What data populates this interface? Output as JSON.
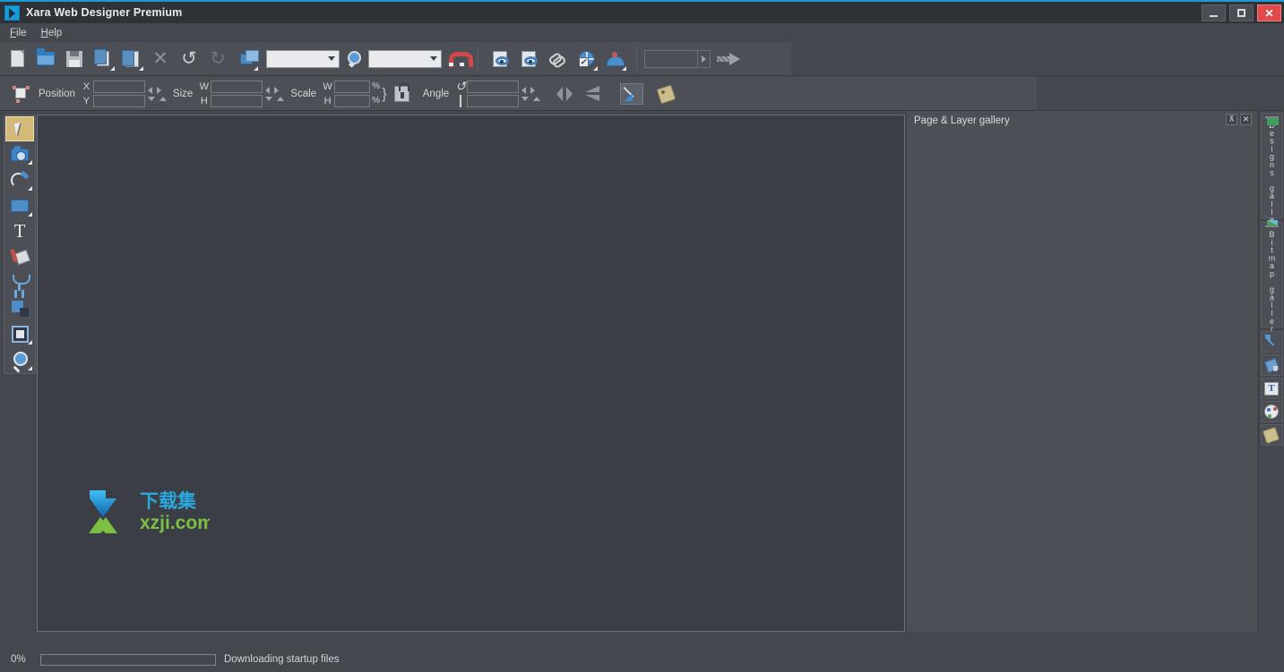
{
  "window": {
    "title": "Xara Web Designer Premium",
    "app_icon": "xara-logo-icon",
    "accent_color": "#1a9ad6",
    "controls": {
      "minimize": "minimize-icon",
      "maximize": "maximize-icon",
      "close": "close-icon"
    }
  },
  "menubar": {
    "items": [
      {
        "label": "File",
        "accesskey": "F"
      },
      {
        "label": "Help",
        "accesskey": "H"
      }
    ]
  },
  "toolbar": {
    "groups": [
      {
        "buttons": [
          {
            "name": "new-document-button",
            "icon": "new-page-icon",
            "label": "New"
          },
          {
            "name": "open-document-button",
            "icon": "open-folder-icon",
            "label": "Open"
          },
          {
            "name": "save-document-button",
            "icon": "save-disk-icon",
            "label": "Save"
          },
          {
            "name": "copy-button",
            "icon": "copy-icon",
            "label": "Copy"
          },
          {
            "name": "paste-button",
            "icon": "paste-icon",
            "label": "Paste"
          },
          {
            "name": "delete-button",
            "icon": "delete-x-icon",
            "label": "Delete"
          },
          {
            "name": "undo-button",
            "icon": "undo-arrow-icon",
            "label": "Undo"
          },
          {
            "name": "redo-button",
            "icon": "redo-arrow-icon",
            "label": "Redo"
          },
          {
            "name": "arrange-button",
            "icon": "arrange-objects-icon",
            "label": "Arrange"
          }
        ]
      }
    ],
    "quality_combo": {
      "value": "",
      "placeholder": ""
    },
    "zoom_tool_icon": "zoom-tool-icon",
    "zoom_combo": {
      "value": "",
      "placeholder": ""
    },
    "snap_button": {
      "icon": "magnet-snap-icon",
      "label": "Snap to objects"
    },
    "web_buttons": [
      {
        "name": "preview-page-button",
        "icon": "preview-page-eye-icon",
        "label": "Preview page"
      },
      {
        "name": "preview-website-button",
        "icon": "preview-website-eye-icon",
        "label": "Preview website"
      },
      {
        "name": "web-link-button",
        "icon": "link-chain-icon",
        "label": "Link"
      },
      {
        "name": "web-properties-button",
        "icon": "globe-check-icon",
        "label": "Web properties"
      },
      {
        "name": "publish-website-button",
        "icon": "publish-globe-icon",
        "label": "Publish website"
      }
    ],
    "address_field": {
      "value": "",
      "placeholder": ""
    },
    "address_dropdown_icon": "chevron-right-icon",
    "go_button": {
      "icon": "go-arrow-icon",
      "label": "Go"
    }
  },
  "infobar": {
    "selection_icon": "selection-handles-icon",
    "position": {
      "label": "Position",
      "x": {
        "label": "X",
        "value": ""
      },
      "y": {
        "label": "Y",
        "value": ""
      }
    },
    "size": {
      "label": "Size",
      "w": {
        "label": "W",
        "value": ""
      },
      "h": {
        "label": "H",
        "value": ""
      }
    },
    "scale": {
      "label": "Scale",
      "w": {
        "label": "W",
        "value": "",
        "unit": "%"
      },
      "h": {
        "label": "H",
        "value": "",
        "unit": "%"
      },
      "lock_icon": "lock-aspect-ratio-icon"
    },
    "angle": {
      "label": "Angle",
      "rotate": {
        "icon": "rotate-icon",
        "value": ""
      },
      "skew": {
        "icon": "skew-icon",
        "value": ""
      }
    },
    "flip_horizontal": {
      "name": "flip-horizontal-button",
      "icon": "flip-horizontal-icon"
    },
    "flip_vertical": {
      "name": "flip-vertical-button",
      "icon": "flip-vertical-icon"
    },
    "line_arrow": {
      "name": "line-arrow-button",
      "icon": "line-arrow-icon",
      "selected": true
    },
    "object_name": {
      "name": "object-name-button",
      "icon": "name-tag-icon"
    }
  },
  "toolbox": {
    "tools": [
      {
        "name": "selector-tool",
        "icon": "selector-arrow-icon",
        "label": "Selector Tool",
        "selected": true,
        "flyout": false
      },
      {
        "name": "photo-tool",
        "icon": "camera-photo-icon",
        "label": "Photo Tool",
        "selected": false,
        "flyout": true
      },
      {
        "name": "freehand-tool",
        "icon": "pen-freehand-icon",
        "label": "Freehand & Brush Tool",
        "selected": false,
        "flyout": true
      },
      {
        "name": "rectangle-tool",
        "icon": "rectangle-icon",
        "label": "Rectangle Tool",
        "selected": false,
        "flyout": true
      },
      {
        "name": "text-tool",
        "icon": "text-t-icon",
        "label": "Text Tool",
        "selected": false,
        "flyout": false
      },
      {
        "name": "fill-tool",
        "icon": "fill-bucket-icon",
        "label": "Fill Tool",
        "selected": false,
        "flyout": false
      },
      {
        "name": "transparency-tool",
        "icon": "transparency-glass-icon",
        "label": "Transparency Tool",
        "selected": false,
        "flyout": false
      },
      {
        "name": "shadow-tool",
        "icon": "shadow-tool-icon",
        "label": "Shadow Tool",
        "selected": false,
        "flyout": false
      },
      {
        "name": "live-effects-tool",
        "icon": "live-effects-icon",
        "label": "Live Effects Tool",
        "selected": false,
        "flyout": true
      },
      {
        "name": "zoom-tool",
        "icon": "magnifier-icon",
        "label": "Zoom Tool",
        "selected": false,
        "flyout": true
      }
    ]
  },
  "canvas": {
    "background_color": "#3b3f45",
    "watermark": {
      "cn_text": "下载集",
      "domain": "xzji.com",
      "logo_colors": [
        "#29a9e0",
        "#1b77c9",
        "#7bc043"
      ]
    }
  },
  "gallery_panel": {
    "title": "Page & Layer gallery",
    "pin_button": {
      "name": "pin-panel-button",
      "icon": "pin-icon",
      "glyph": "⊼"
    },
    "close_button": {
      "name": "close-panel-button",
      "icon": "close-icon",
      "glyph": "✕"
    }
  },
  "right_rail": {
    "tabs": [
      {
        "name": "designs-gallery-tab",
        "label": "Designs gallery",
        "icon": "designs-gallery-icon"
      },
      {
        "name": "bitmap-gallery-tab",
        "label": "Bitmap gallery",
        "icon": "bitmap-gallery-icon"
      }
    ],
    "buttons": [
      {
        "name": "scale-gallery-button",
        "icon": "resize-arrow-icon"
      },
      {
        "name": "fill-gallery-button",
        "icon": "fill-bucket-icon"
      },
      {
        "name": "font-gallery-button",
        "icon": "font-text-icon"
      },
      {
        "name": "color-gallery-button",
        "icon": "color-palette-icon"
      },
      {
        "name": "name-gallery-button",
        "icon": "name-tag-icon"
      }
    ]
  },
  "statusbar": {
    "progress_percent": "0%",
    "progress_value": 0,
    "message": "Downloading startup files"
  }
}
